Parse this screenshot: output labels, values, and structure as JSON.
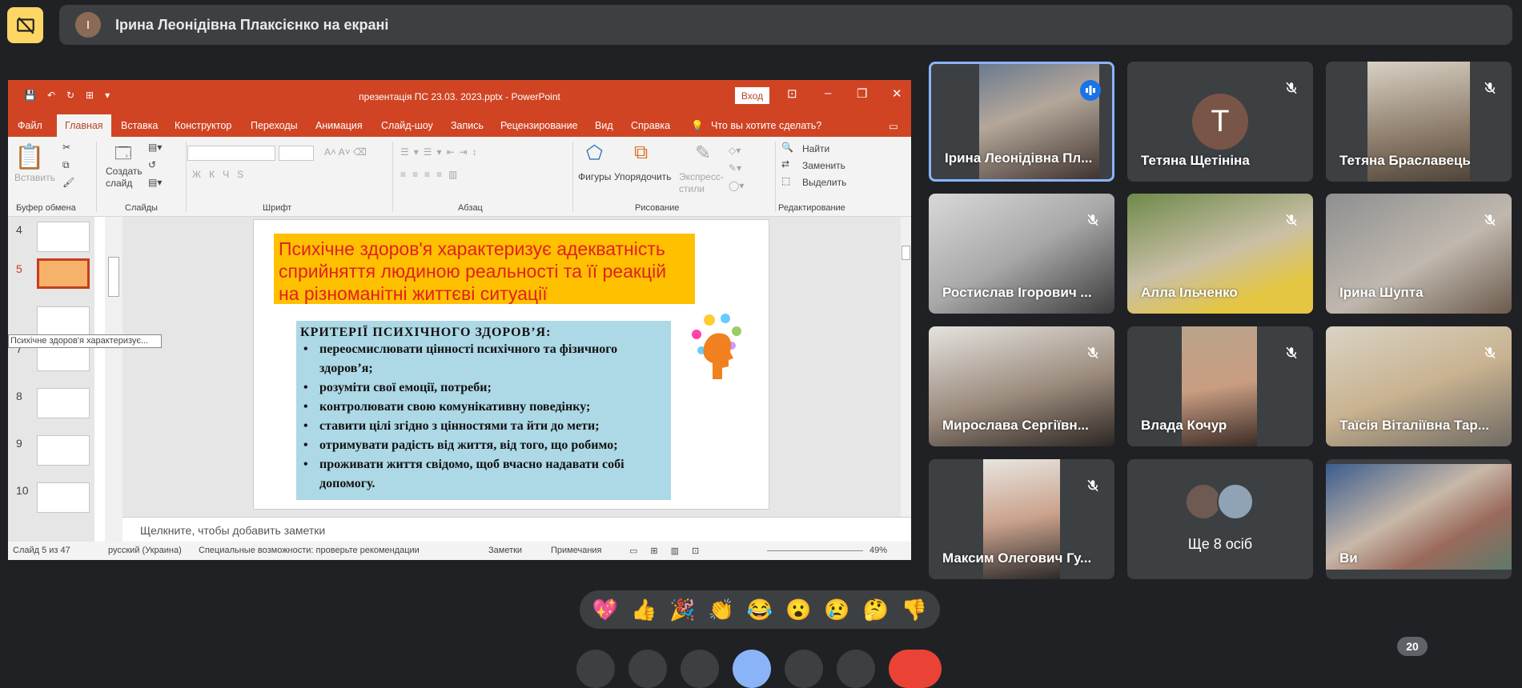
{
  "meet": {
    "presenter_initial": "І",
    "presenter_banner": "Ірина Леонідівна Плаксієнко на екрані",
    "participant_count": "20",
    "reactions": [
      "💖",
      "👍",
      "🎉",
      "👏",
      "😂",
      "😮",
      "😢",
      "🤔",
      "👎"
    ],
    "others_label": "Ще 8 осіб",
    "tiles": [
      {
        "name": "Ірина Леонідівна Пл...",
        "speaking": true
      },
      {
        "name": "Тетяна Щетініна",
        "initial": "T",
        "muted": true
      },
      {
        "name": "Тетяна Браславець",
        "muted": true
      },
      {
        "name": "Ростислав Ігорович ...",
        "muted": true
      },
      {
        "name": "Алла Ільченко",
        "muted": true
      },
      {
        "name": "Ірина Шупта",
        "muted": true
      },
      {
        "name": "Мирослава Сергіївн...",
        "muted": true
      },
      {
        "name": "Влада Кочур",
        "muted": true
      },
      {
        "name": "Таїсія Віталіївна Тар...",
        "muted": true
      },
      {
        "name": "Максим Олегович Гу...",
        "muted": true
      },
      {
        "name": "Ви"
      }
    ],
    "colors": {
      "accent": "#fdd663",
      "tile": "#3c4043",
      "speaking_border": "#8ab4f8"
    }
  },
  "powerpoint": {
    "title": "презентація ПС 23.03. 2023.pptx  -  PowerPoint",
    "login": "Вход",
    "menu": [
      "Файл",
      "Главная",
      "Вставка",
      "Конструктор",
      "Переходы",
      "Анимация",
      "Слайд-шоу",
      "Запись",
      "Рецензирование",
      "Вид",
      "Справка"
    ],
    "tell_me": "Что вы хотите сделать?",
    "ribbon": {
      "paste": "Вставить",
      "new_slide": "Создать слайд",
      "shapes": "Фигуры",
      "arrange": "Упорядочить",
      "express_styles": "Экспресс-стили",
      "find": "Найти",
      "replace": "Заменить",
      "select": "Выделить",
      "groups": [
        "Буфер обмена",
        "Слайды",
        "Шрифт",
        "Абзац",
        "Рисование",
        "Редактирование"
      ]
    },
    "thumb_numbers": [
      "4",
      "5",
      "7",
      "8",
      "9",
      "10"
    ],
    "tooltip": "Психічне здоров'я характеризує...",
    "slide": {
      "title": "Психічне здоров'я характеризує адекватність сприйняття людиною реальності та її реакцій  на різноманітні життєві ситуації",
      "heading": "КРИТЕРІЇ  ПСИХІЧНОГО  ЗДОРОВ’Я:",
      "bullets": [
        "переосмислювати цінності психічного та фізичного здоров’я;",
        "розуміти свої емоції, потреби;",
        "контролювати свою комунікативну поведінку;",
        "ставити цілі згідно з цінностями та йти до мети;",
        "отримувати радість від життя, від того, що робимо;",
        "проживати життя свідомо, щоб вчасно надавати собі допомогу."
      ]
    },
    "notes_placeholder": "Щелкните, чтобы добавить заметки",
    "status": {
      "slide": "Слайд 5 из 47",
      "lang": "русский (Украина)",
      "accessibility": "Специальные возможности: проверьте рекомендации",
      "notes": "Заметки",
      "comments": "Примечания",
      "zoom": "49%"
    }
  }
}
